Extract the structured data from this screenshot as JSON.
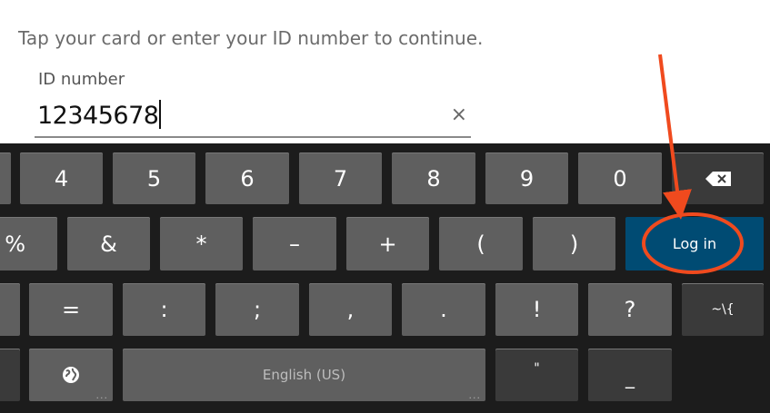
{
  "prompt": "Tap your card or enter your ID number to continue.",
  "id_field": {
    "label": "ID number",
    "value": "12345678",
    "clear_icon": "×"
  },
  "keyboard": {
    "row1": [
      "4",
      "5",
      "6",
      "7",
      "8",
      "9",
      "0"
    ],
    "backspace_icon": "backspace-icon",
    "row2": [
      "%",
      "&",
      "*",
      "–",
      "+",
      "(",
      ")"
    ],
    "enter_label": "Log in",
    "row3": [
      "=",
      ":",
      ";",
      ",",
      ".",
      "!",
      "?"
    ],
    "symbols_label": "~\\{",
    "globe_icon": "globe-icon",
    "space_label": "English (US)",
    "quote_key": "\"",
    "underscore_key": "_",
    "more_indicator": "..."
  },
  "colors": {
    "enter_key": "#004b73",
    "annotation": "#f04a1e"
  }
}
